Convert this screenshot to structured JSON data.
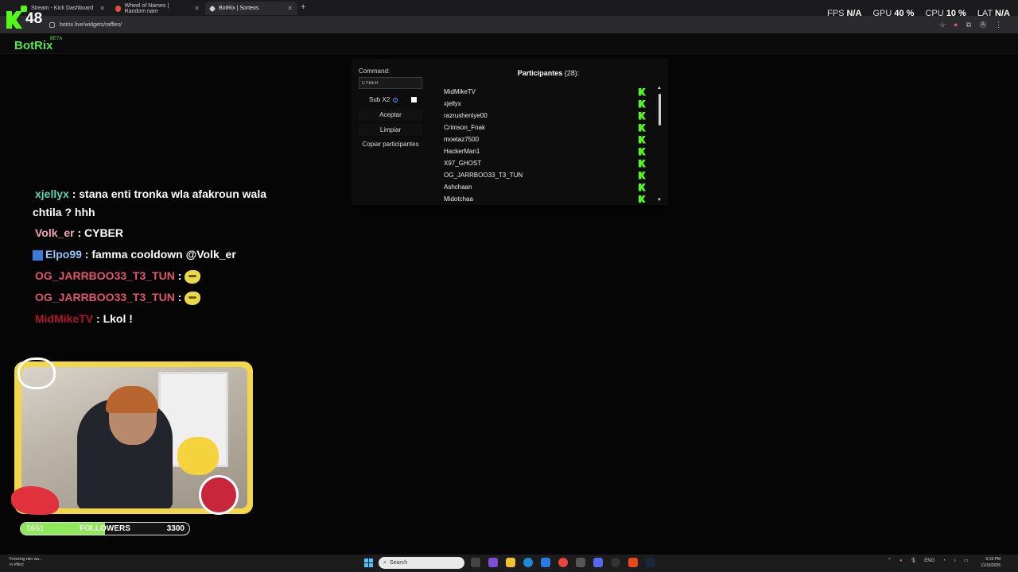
{
  "browser": {
    "tabs": [
      {
        "title": "Stream - Kick Dashboard",
        "active": false
      },
      {
        "title": "Wheel of Names | Random nam",
        "active": false
      },
      {
        "title": "BotRix | Sorteos",
        "active": true
      }
    ],
    "url": "botrix.live/widgets/raffles/",
    "profile_initial": "A"
  },
  "overlay": {
    "viewer_count": "48",
    "perf": {
      "fps_label": "FPS",
      "fps_value": "N/A",
      "gpu_label": "GPU",
      "gpu_value": "40 %",
      "cpu_label": "CPU",
      "cpu_value": "10 %",
      "lat_label": "LAT",
      "lat_value": "N/A"
    }
  },
  "page": {
    "logo": "BotRix",
    "logo_badge": "BETA"
  },
  "raffle": {
    "command_label": "Command:",
    "command_value": "CYBER",
    "sub_label": "Sub X2",
    "sub_checked": true,
    "accept_label": "Aceptar",
    "clear_label": "Limpiar",
    "copy_label": "Copiar participantes",
    "participants_title": "Participantes",
    "participants_count": "(28):",
    "participants": [
      "MidMikeTV",
      "xjellyx",
      "razrusheniye00",
      "Crimson_Fnak",
      "moetaz7500",
      "HackerMan1",
      "X97_GHOST",
      "OG_JARRBOO33_T3_TUN",
      "Ashchaan",
      "Midotchaa"
    ]
  },
  "chat": [
    {
      "user": "xjellyx",
      "user_color": "#5ad6b0",
      "text": ": stana enti tronka wla afakroun wala",
      "text2": "chtila ? hhh",
      "emote": false
    },
    {
      "user": "Volk_er",
      "user_color": "#f4a3b4",
      "text": ": CYBER",
      "emote": false
    },
    {
      "user": "Elpo99",
      "user_color": "#8fc7ff",
      "text": ": famma cooldown @Volk_er",
      "emote": false,
      "badge": true
    },
    {
      "user": "OG_JARRBOO33_T3_TUN",
      "user_color": "#e0566d",
      "text": ":",
      "emote": true
    },
    {
      "user": "OG_JARRBOO33_T3_TUN",
      "user_color": "#e0566d",
      "text": ":",
      "emote": true
    },
    {
      "user": "MidMikeTV",
      "user_color": "#b3132b",
      "text": ": Lkol !",
      "emote": false
    }
  ],
  "followers": {
    "current": "1651",
    "label": "FOLLOWERS",
    "goal": "3300",
    "progress_fraction": 0.5
  },
  "taskbar": {
    "weather_line1": "Freezing rain wa...",
    "weather_line2": "In effect",
    "search_placeholder": "Search",
    "lang": "ENG",
    "time": "6:19 PM",
    "date": "11/15/2025"
  },
  "colors": {
    "kick_green": "#53fc18",
    "botrix_green": "#54e34a",
    "frame_yellow": "#f2d74a"
  }
}
